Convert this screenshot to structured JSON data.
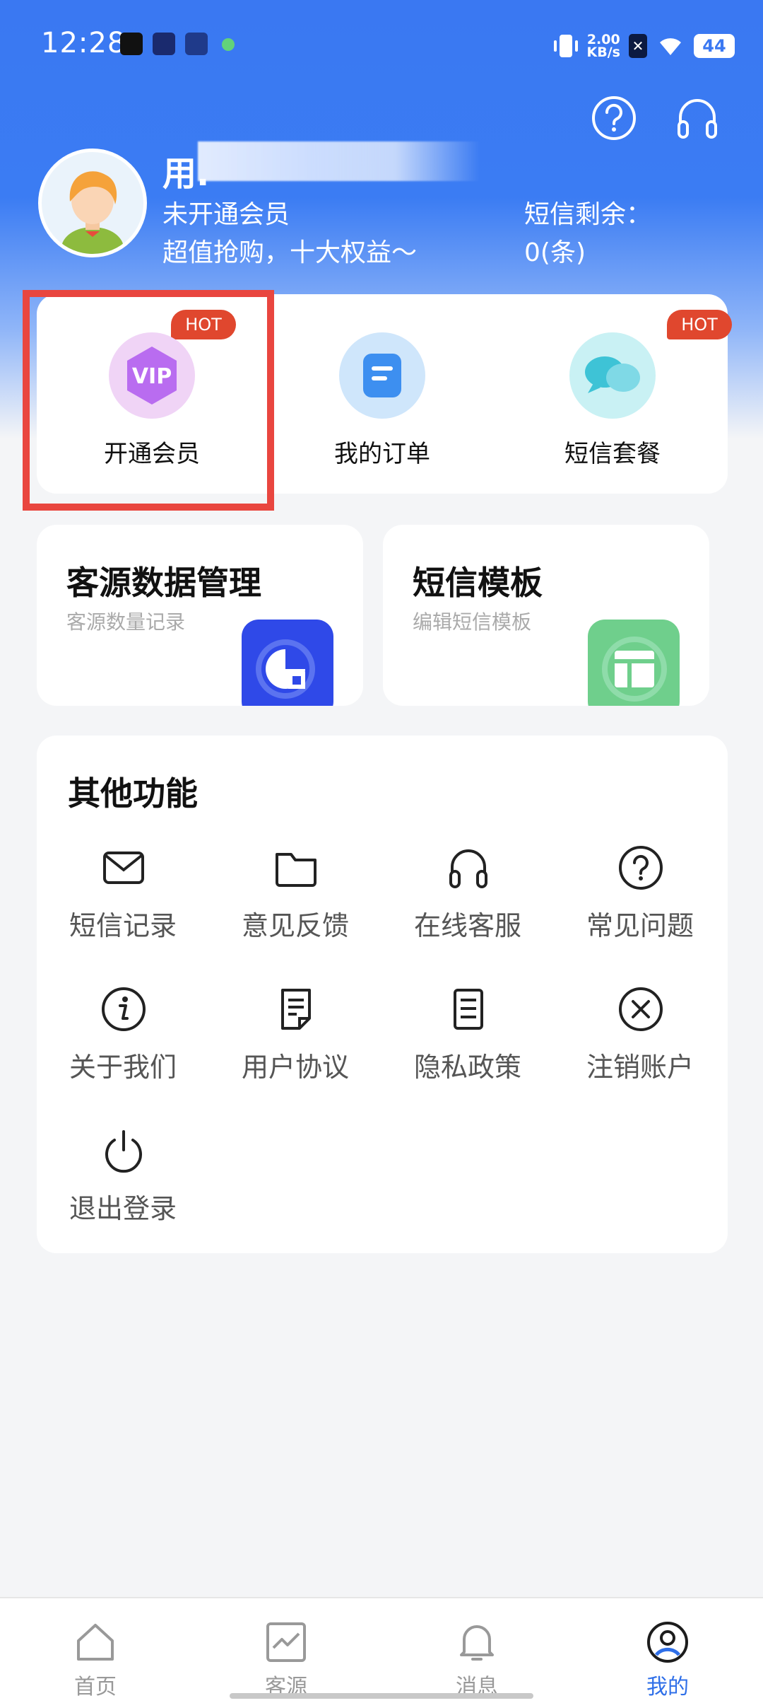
{
  "status_bar": {
    "time": "12:28",
    "net_speed_value": "2.00",
    "net_speed_unit": "KB/s",
    "battery": "44"
  },
  "header": {
    "help_icon": "question-circle-icon",
    "service_icon": "headphones-icon"
  },
  "profile": {
    "username": "用.",
    "member_status": "未开通会员",
    "promo": "超值抢购，十大权益～",
    "sms_remaining_label": "短信剩余：",
    "sms_remaining_value": "0(条)"
  },
  "quick_actions": [
    {
      "label": "开通会员",
      "badge": "HOT",
      "icon": "vip-icon"
    },
    {
      "label": "我的订单",
      "badge": "",
      "icon": "order-icon"
    },
    {
      "label": "短信套餐",
      "badge": "HOT",
      "icon": "sms-package-icon"
    }
  ],
  "feature_cards": [
    {
      "title": "客源数据管理",
      "subtitle": "客源数量记录",
      "icon": "customer-data-icon"
    },
    {
      "title": "短信模板",
      "subtitle": "编辑短信模板",
      "icon": "sms-template-icon"
    }
  ],
  "other": {
    "title": "其他功能",
    "items": [
      {
        "label": "短信记录",
        "icon": "mail-icon"
      },
      {
        "label": "意见反馈",
        "icon": "folder-icon"
      },
      {
        "label": "在线客服",
        "icon": "headphones-icon"
      },
      {
        "label": "常见问题",
        "icon": "question-circle-icon"
      },
      {
        "label": "关于我们",
        "icon": "info-icon"
      },
      {
        "label": "用户协议",
        "icon": "document-icon"
      },
      {
        "label": "隐私政策",
        "icon": "list-document-icon"
      },
      {
        "label": "注销账户",
        "icon": "close-circle-icon"
      },
      {
        "label": "退出登录",
        "icon": "power-icon"
      }
    ]
  },
  "bottom_nav": [
    {
      "label": "首页",
      "icon": "home-icon",
      "active": false
    },
    {
      "label": "客源",
      "icon": "chart-icon",
      "active": false
    },
    {
      "label": "消息",
      "icon": "bell-icon",
      "active": false
    },
    {
      "label": "我的",
      "icon": "user-circle-icon",
      "active": true
    }
  ],
  "colors": {
    "primary": "#3a78f2",
    "hot": "#e0472e",
    "highlight": "#e9463f",
    "nav_active": "#2f6fe8"
  }
}
